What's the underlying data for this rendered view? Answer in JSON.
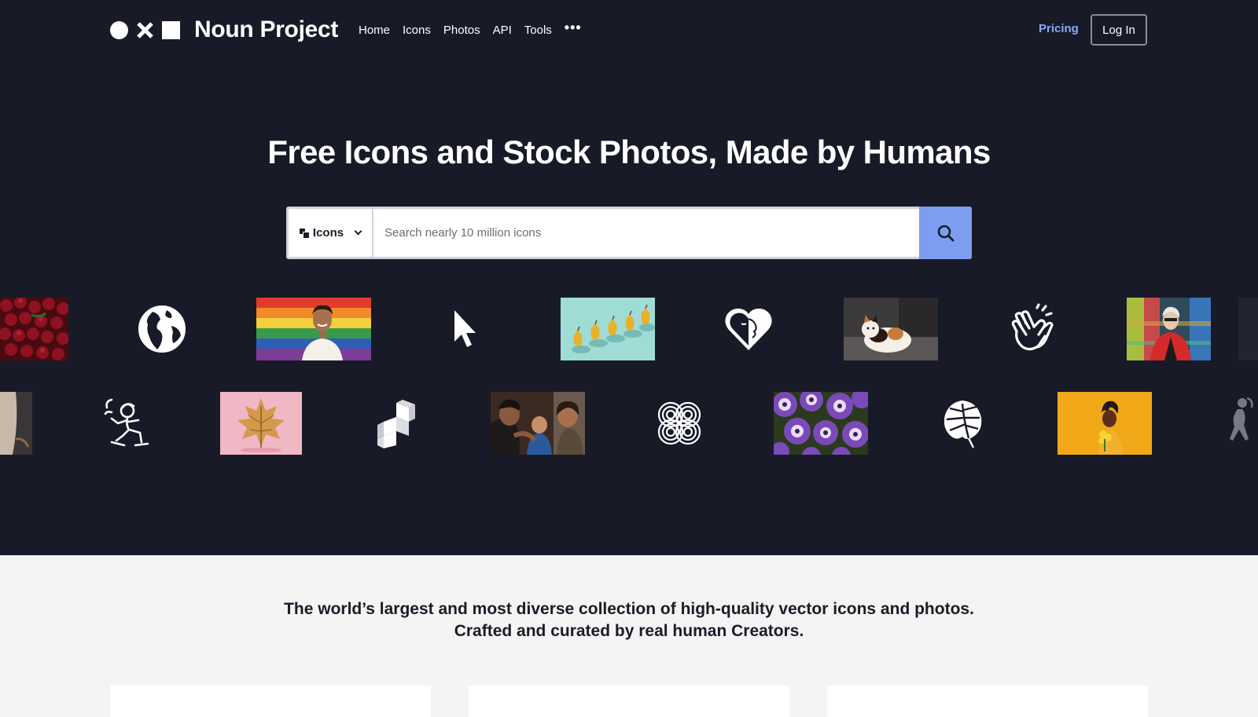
{
  "header": {
    "brand": "Noun Project",
    "nav": [
      "Home",
      "Icons",
      "Photos",
      "API",
      "Tools"
    ],
    "more": "•••",
    "pricing": "Pricing",
    "login": "Log In"
  },
  "hero": {
    "headline": "Free Icons and Stock Photos, Made by Humans"
  },
  "search": {
    "type_label": "Icons",
    "placeholder": "Search nearly 10 million icons",
    "value": ""
  },
  "carousel": {
    "row1": [
      "cherries-photo",
      "globe-icon",
      "pride-portrait-photo",
      "cursor-icon",
      "pears-photo",
      "heart-face-icon",
      "calico-cat-photo",
      "clapping-hands-icon",
      "red-jacket-portrait-photo"
    ],
    "row2": [
      "person-photo-partial",
      "skateboarder-icon",
      "maple-leaf-photo",
      "blocks-icon",
      "family-baby-photo",
      "knot-pattern-icon",
      "petunias-photo",
      "monstera-leaf-icon",
      "yellow-portrait-photo",
      "dancer-icon-partial"
    ]
  },
  "tagline": {
    "line1": "The world’s largest and most diverse collection of high-quality vector icons and photos.",
    "line2": "Crafted and curated by real human Creators."
  },
  "colors": {
    "hero_bg": "#181a28",
    "accent": "#7d9ef0",
    "pricing": "#8aa8f4",
    "page_bg": "#f4f4f4"
  }
}
